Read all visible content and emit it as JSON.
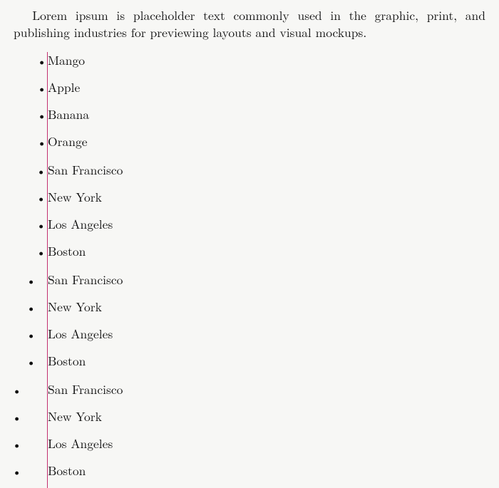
{
  "paragraph": "Lorem ipsum is placeholder text commonly used in the graphic, print, and publishing industries for previewing layouts and visual mockups.",
  "groups": [
    {
      "items": [
        "Mango",
        "Apple",
        "Banana",
        "Orange"
      ]
    },
    {
      "items": [
        "San Francisco",
        "New York",
        "Los Angeles",
        "Boston"
      ]
    },
    {
      "items": [
        "San Francisco",
        "New York",
        "Los Angeles",
        "Boston"
      ]
    },
    {
      "items": [
        "San Francisco",
        "New York",
        "Los Angeles",
        "Boston"
      ]
    }
  ]
}
